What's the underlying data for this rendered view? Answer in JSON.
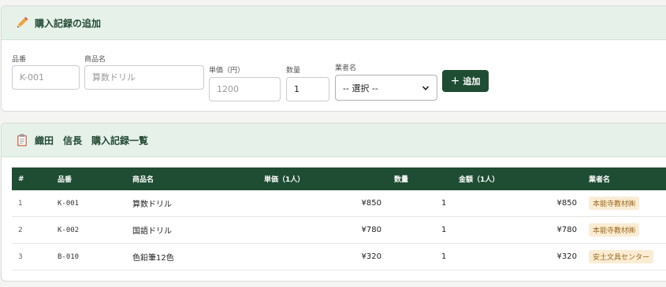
{
  "form_card": {
    "title": "購入記録の追加",
    "code_label": "品番",
    "code_placeholder": "K-001",
    "name_label": "商品名",
    "name_placeholder": "算数ドリル",
    "price_label": "単価（円）",
    "price_placeholder": "1200",
    "qty_label": "数量",
    "qty_value": "1",
    "vendor_label": "業者名",
    "vendor_selected": "-- 選択 --",
    "add_label": "追加",
    "add_icon": "+"
  },
  "list_card": {
    "title": "織田　信長　購入記録一覧",
    "columns": [
      "#",
      "品番",
      "商品名",
      "単価（1人）",
      "数量",
      "金額（1人）",
      "業者名"
    ],
    "rows": [
      {
        "index": "1",
        "code": "K-001",
        "name": "算数ドリル",
        "price": "¥850",
        "qty": "1",
        "amount": "¥850",
        "vendor": "本能寺教材㈱"
      },
      {
        "index": "2",
        "code": "K-002",
        "name": "国語ドリル",
        "price": "¥780",
        "qty": "1",
        "amount": "¥780",
        "vendor": "本能寺教材㈱"
      },
      {
        "index": "3",
        "code": "B-010",
        "name": "色鉛筆12色",
        "price": "¥320",
        "qty": "1",
        "amount": "¥320",
        "vendor": "安土文具センター"
      }
    ]
  },
  "colors": {
    "header_bg": "#e6f1ea",
    "primary": "#1f4d33",
    "badge_bg": "#fbecd4",
    "badge_text": "#9a6a1c"
  }
}
